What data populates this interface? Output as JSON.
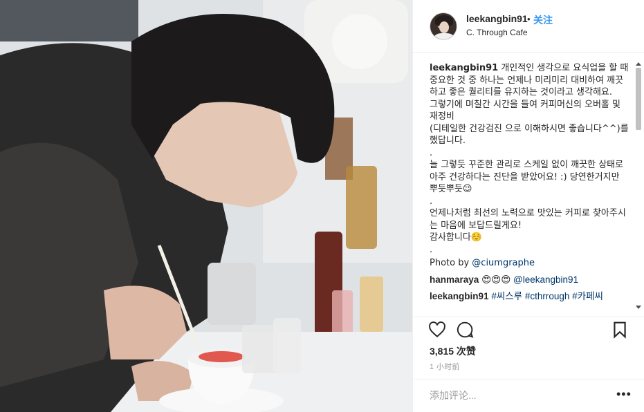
{
  "post": {
    "username": "leekangbin91",
    "follow_dot": "•",
    "follow_label": "关注",
    "location": "C. Through Cafe",
    "likes": "3,815 次赞",
    "time": "1 小时前"
  },
  "caption": {
    "username": "leekangbin91",
    "text": "개인적인 생각으로 요식업을 할 때 중요한 것 중 하나는 언제나 미리미리 대비하여 깨끗하고 좋은 퀄리티를 유지하는 것이라고 생각해요.\n그렇기에 며칠간 시간을 들여 커피머신의 오버홀 및 재정비\n(디테일한 건강검진 으로 이해하시면 좋습니다^^)를 했답니다.\n.\n늘 그렇듯 꾸준한 관리로 스케일 없이 깨끗한 상태로 아주 건강하다는 진단을 받았어요! :) 당연한거지만 뿌듯뿌듯😉\n.\n언제나처럼 최선의 노력으로 맛있는 커피로 찾아주시는 마음에 보답드릴게요!\n감사합니다☺️\n.",
    "credit_prefix": "Photo by ",
    "credit_handle": "@ciumgraphe"
  },
  "comments": [
    {
      "username": "hanmaraya",
      "emoji": "😍😍😍 ",
      "mention": "@leekangbin91"
    },
    {
      "username": "leekangbin91",
      "tags": "#씨스루 #cthrrough #카페씨"
    }
  ],
  "comment_input": {
    "placeholder": "添加评论..."
  },
  "more_label": "•••",
  "icons": {
    "like": "heart-icon",
    "comment": "comment-bubble-icon",
    "save": "bookmark-icon"
  }
}
